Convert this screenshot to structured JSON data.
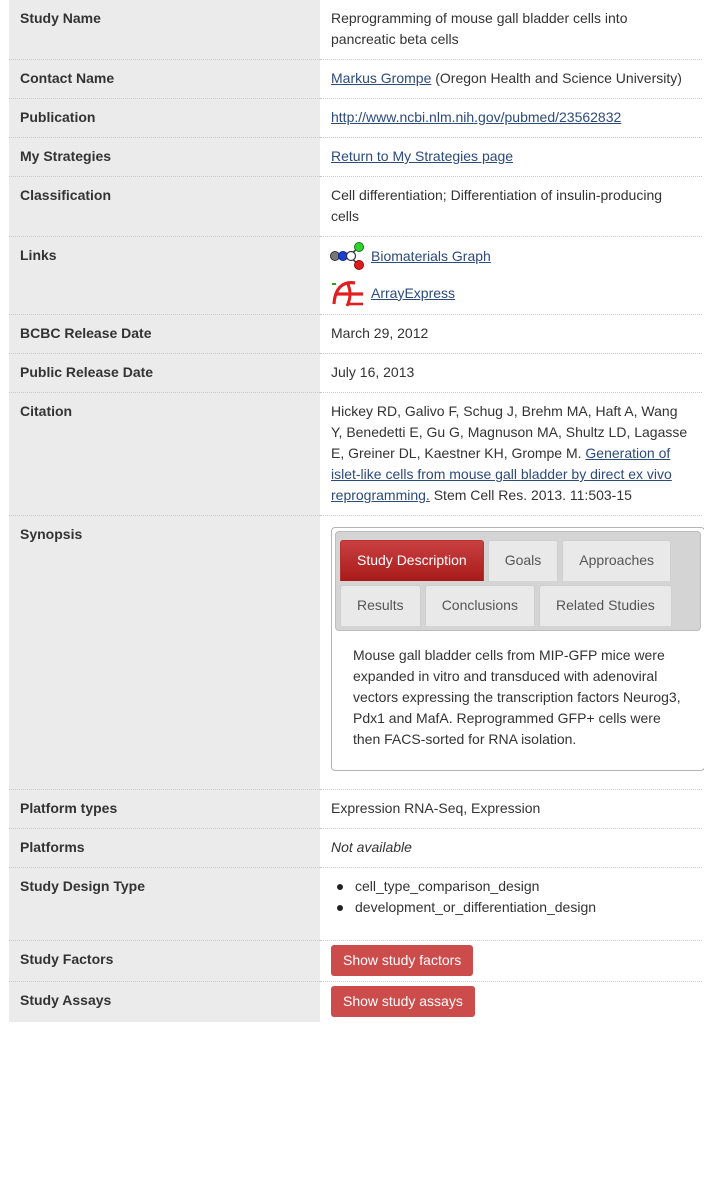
{
  "rows": {
    "study_name": {
      "label": "Study Name",
      "value": "Reprogramming of mouse gall bladder cells into pancreatic beta cells"
    },
    "contact": {
      "label": "Contact Name",
      "link": "Markus Grompe",
      "rest": "(Oregon Health and Science University)"
    },
    "publication": {
      "label": "Publication",
      "link": "http://www.ncbi.nlm.nih.gov/pubmed/23562832"
    },
    "strategies": {
      "label": "My Strategies",
      "link": "Return to My Strategies page"
    },
    "classification": {
      "label": "Classification",
      "value": "Cell differentiation; Differentiation of insulin-producing cells"
    },
    "links": {
      "label": "Links",
      "items": [
        {
          "text": "Biomaterials Graph",
          "icon": "graph-icon"
        },
        {
          "text": "ArrayExpress",
          "icon": "arrayexpress-icon"
        }
      ]
    },
    "bcbc_date": {
      "label": "BCBC Release Date",
      "value": "March 29, 2012"
    },
    "public_date": {
      "label": "Public Release Date",
      "value": "July 16, 2013"
    },
    "citation": {
      "label": "Citation",
      "authors": "Hickey RD, Galivo F, Schug J, Brehm MA, Haft A, Wang Y, Benedetti E, Gu G, Magnuson MA, Shultz LD, Lagasse E, Greiner DL, Kaestner KH, Grompe M.",
      "title": "Generation of islet-like cells from mouse gall bladder by direct ex vivo reprogramming.",
      "journal": "Stem Cell Res. 2013. 11:503-15"
    },
    "synopsis": {
      "label": "Synopsis",
      "tabs": [
        "Study Description",
        "Goals",
        "Approaches",
        "Results",
        "Conclusions",
        "Related Studies"
      ],
      "active_tab": "Study Description",
      "body": "Mouse gall bladder cells from MIP-GFP mice were expanded in vitro and transduced with adenoviral vectors expressing the transcription factors Neurog3, Pdx1 and MafA. Reprogrammed GFP+ cells were then FACS-sorted for RNA isolation."
    },
    "platform_types": {
      "label": "Platform types",
      "value": "Expression RNA-Seq, Expression"
    },
    "platforms": {
      "label": "Platforms",
      "value": "Not available"
    },
    "design_type": {
      "label": "Study Design Type",
      "items": [
        "cell_type_comparison_design",
        "development_or_differentiation_design"
      ]
    },
    "factors": {
      "label": "Study Factors",
      "button": "Show study factors"
    },
    "assays": {
      "label": "Study Assays",
      "button": "Show study assays"
    }
  },
  "colors": {
    "label_bg": "#ebebeb",
    "link": "#2c4a7c",
    "button": "#cc4b4b",
    "tab_active": "#b52a2a"
  }
}
